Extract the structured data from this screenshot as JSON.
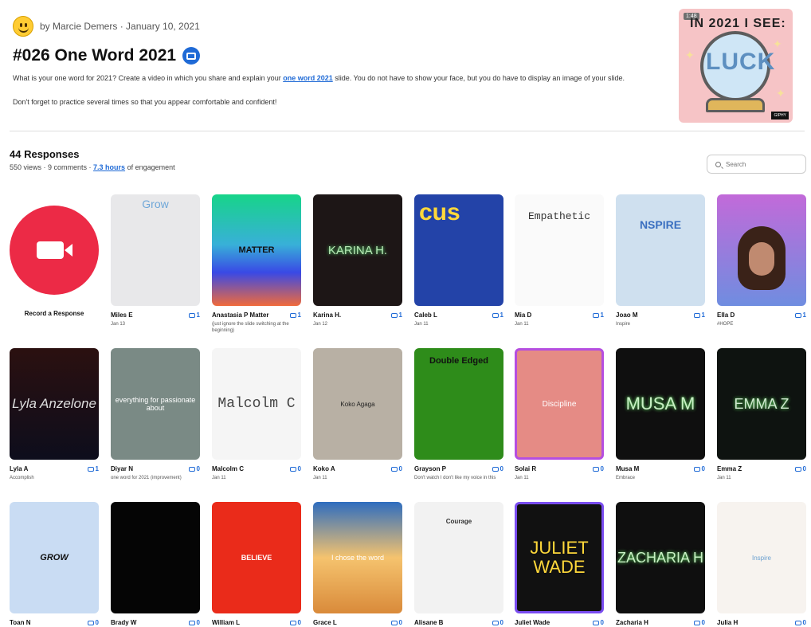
{
  "post": {
    "byline": "by Marcie Demers · January 10, 2021",
    "title": "#026 One Word 2021",
    "desc_before": "What is your one word for 2021?  Create a video in which you share and explain your ",
    "desc_link": "one word 2021",
    "desc_after": " slide. You do not have to show your face, but you do have to display an image of your slide.",
    "reminder": "Don't forget to practice several times so that you appear comfortable and confident!",
    "cover": {
      "top_text": "IN 2021 I SEE:",
      "center_text": "LUCK",
      "badge": "1:48",
      "giphy": "GIPHY"
    }
  },
  "responses": {
    "count_label": "44 Responses",
    "stats_before": "550 views · 9 comments · ",
    "stats_link": "7.3 hours",
    "stats_after": " of engagement",
    "search_placeholder": "Search",
    "record_label": "Record a Response"
  },
  "cards": [
    {
      "name": "Miles E",
      "comments": "1",
      "sub": "Jan 13",
      "thumb": "Grow"
    },
    {
      "name": "Anastasia P Matter",
      "comments": "1",
      "sub": "(just ignore the slide switching at the beginning)",
      "thumb": "MATTER"
    },
    {
      "name": "Karina H.",
      "comments": "1",
      "sub": "Jan 12",
      "thumb": "KARINA H."
    },
    {
      "name": "Caleb L",
      "comments": "1",
      "sub": "Jan 11",
      "thumb": "cus"
    },
    {
      "name": "Mia D",
      "comments": "1",
      "sub": "Jan 11",
      "thumb": "Empathetic"
    },
    {
      "name": "Joao M",
      "comments": "1",
      "sub": "Inspire",
      "thumb": "NSPIRE"
    },
    {
      "name": "Ella D",
      "comments": "1",
      "sub": "#HOPE",
      "thumb": ""
    },
    {
      "name": "Lyla A",
      "comments": "1",
      "sub": "Accomplish",
      "thumb": "Lyla Anzelone"
    },
    {
      "name": "Diyar N",
      "comments": "0",
      "sub": "one word for 2021 (improvement)",
      "thumb": "everything for passionate about"
    },
    {
      "name": "Malcolm C",
      "comments": "0",
      "sub": "Jan 11",
      "thumb": "Malcolm C"
    },
    {
      "name": "Koko A",
      "comments": "0",
      "sub": "Jan 11",
      "thumb": "Koko Agaga"
    },
    {
      "name": "Grayson P",
      "comments": "0",
      "sub": "Don't watch I don't like my voice in this",
      "thumb": "Double Edged"
    },
    {
      "name": "Solai R",
      "comments": "0",
      "sub": "Jan 11",
      "thumb": "Discipline"
    },
    {
      "name": "Musa M",
      "comments": "0",
      "sub": "Embrace",
      "thumb": "MUSA M"
    },
    {
      "name": "Emma Z",
      "comments": "0",
      "sub": "Jan 11",
      "thumb": "EMMA Z"
    },
    {
      "name": "Toan N",
      "comments": "0",
      "sub": "",
      "thumb": "GROW"
    },
    {
      "name": "Brady W",
      "comments": "0",
      "sub": "",
      "thumb": ""
    },
    {
      "name": "William L",
      "comments": "0",
      "sub": "",
      "thumb": "BELIEVE"
    },
    {
      "name": "Grace L",
      "comments": "0",
      "sub": "",
      "thumb": "I chose the word"
    },
    {
      "name": "Alisane B",
      "comments": "0",
      "sub": "",
      "thumb": "Courage"
    },
    {
      "name": "Juliet Wade",
      "comments": "0",
      "sub": "",
      "thumb": "JULIET WADE"
    },
    {
      "name": "Zacharia H",
      "comments": "0",
      "sub": "",
      "thumb": "ZACHARIA H"
    },
    {
      "name": "Julia H",
      "comments": "0",
      "sub": "",
      "thumb": "Inspire"
    }
  ]
}
